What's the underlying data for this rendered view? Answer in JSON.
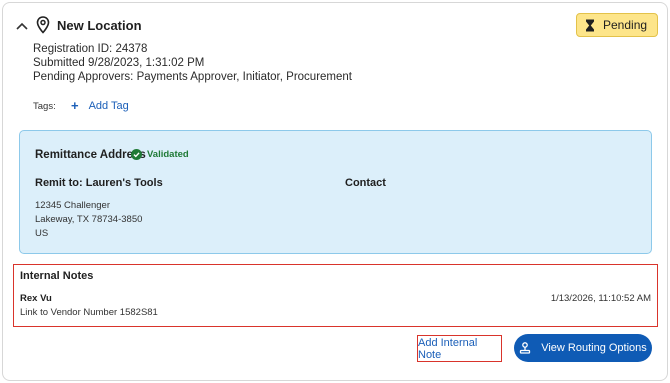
{
  "header": {
    "title": "New Location",
    "status": "Pending",
    "icons": {
      "collapse": "chevron-up-icon",
      "location": "map-pin-icon",
      "status": "hourglass-icon"
    }
  },
  "registration": {
    "id_line": "Registration ID: 24378",
    "submitted_line": "Submitted 9/28/2023, 1:31:02 PM",
    "approvers_line": "Pending Approvers: Payments Approver, Initiator, Procurement"
  },
  "tags": {
    "label": "Tags:",
    "add_label": "Add Tag"
  },
  "remittance": {
    "title": "Remittance Address",
    "validated_label": "Validated",
    "remit_to": "Remit to: Lauren's Tools",
    "contact_label": "Contact",
    "address_lines": [
      "12345 Challenger",
      "Lakeway, TX 78734-3850",
      "US"
    ]
  },
  "internal_notes": {
    "title": "Internal Notes",
    "notes": [
      {
        "author": "Rex Vu",
        "date": "1/13/2026, 11:10:52 AM",
        "text": "Link to Vendor Number 1582S81"
      }
    ]
  },
  "actions": {
    "add_note_label": "Add Internal Note",
    "routing_label": "View Routing Options"
  },
  "colors": {
    "status_bg": "#fde58a",
    "remit_bg": "#dceffa",
    "accent": "#0f5bb5",
    "highlight": "#d9342b",
    "validated": "#1f7a36"
  }
}
